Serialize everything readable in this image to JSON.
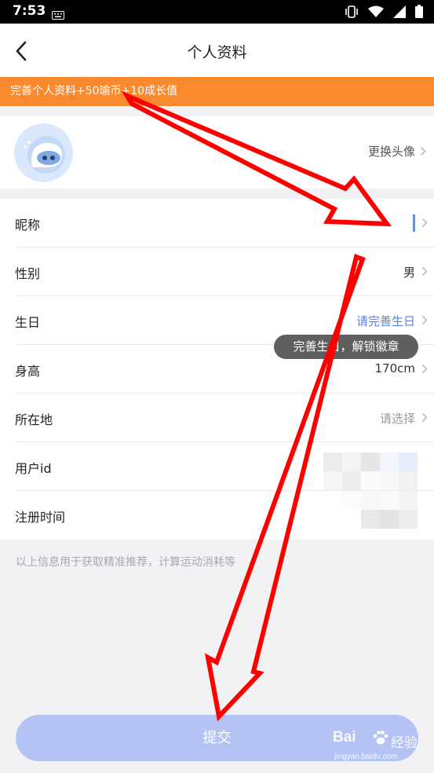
{
  "status_bar": {
    "time": "7:53"
  },
  "header": {
    "title": "个人资料"
  },
  "banner": {
    "text": "完善个人资料+50瑜币+10成长值"
  },
  "avatar_section": {
    "change_label": "更换头像"
  },
  "fields": {
    "nickname": {
      "label": "昵称",
      "value": ""
    },
    "gender": {
      "label": "性别",
      "value": "男"
    },
    "birthday": {
      "label": "生日",
      "value": "请完善生日"
    },
    "height": {
      "label": "身高",
      "value": "170cm"
    },
    "location": {
      "label": "所在地",
      "value": "请选择"
    },
    "user_id": {
      "label": "用户id"
    },
    "register_time": {
      "label": "注册时间"
    }
  },
  "tooltip": {
    "text": "完善生日，解锁徽章"
  },
  "footer_note": "以上信息用于获取精准推荐，计算运动消耗等",
  "submit_label": "提交",
  "watermark": {
    "brand": "Bai",
    "suffix": "经验",
    "url": "jingyan.baidu.com"
  },
  "colors": {
    "banner": "#fb8a2f",
    "link": "#5b83e6",
    "submit": "#b4c3f3",
    "annotation_arrow": "#ff0000"
  }
}
